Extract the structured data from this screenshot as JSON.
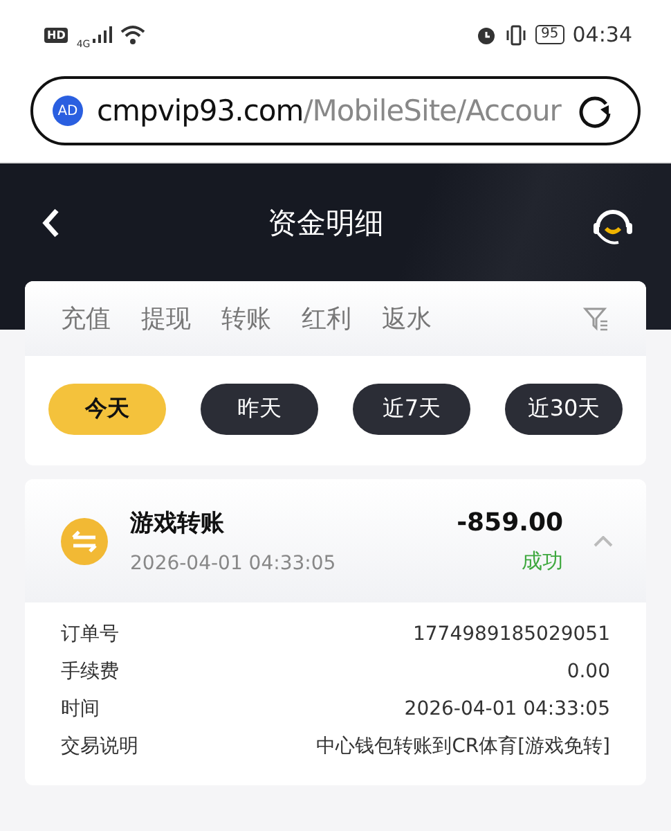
{
  "status_bar": {
    "hd": "HD",
    "network": "4G",
    "battery": "95",
    "time": "04:34"
  },
  "address_bar": {
    "domain": "cmpvip93.com",
    "path": "/MobileSite/Accour",
    "badge": "AD"
  },
  "header": {
    "title": "资金明细"
  },
  "tabs": [
    {
      "label": "充值"
    },
    {
      "label": "提现"
    },
    {
      "label": "转账"
    },
    {
      "label": "红利"
    },
    {
      "label": "返水"
    }
  ],
  "date_filters": [
    {
      "label": "今天",
      "selected": true
    },
    {
      "label": "昨天",
      "selected": false
    },
    {
      "label": "近7天",
      "selected": false
    },
    {
      "label": "近30天",
      "selected": false
    }
  ],
  "transactions": [
    {
      "title": "游戏转账",
      "time": "2026-04-01 04:33:05",
      "amount": "-859.00",
      "status": "成功",
      "expanded": true,
      "details": [
        {
          "label": "订单号",
          "value": "1774989185029051"
        },
        {
          "label": "手续费",
          "value": "0.00"
        },
        {
          "label": "时间",
          "value": "2026-04-01 04:33:05"
        },
        {
          "label": "交易说明",
          "value": "中心钱包转账到CR体育[游戏免转]"
        }
      ]
    }
  ]
}
